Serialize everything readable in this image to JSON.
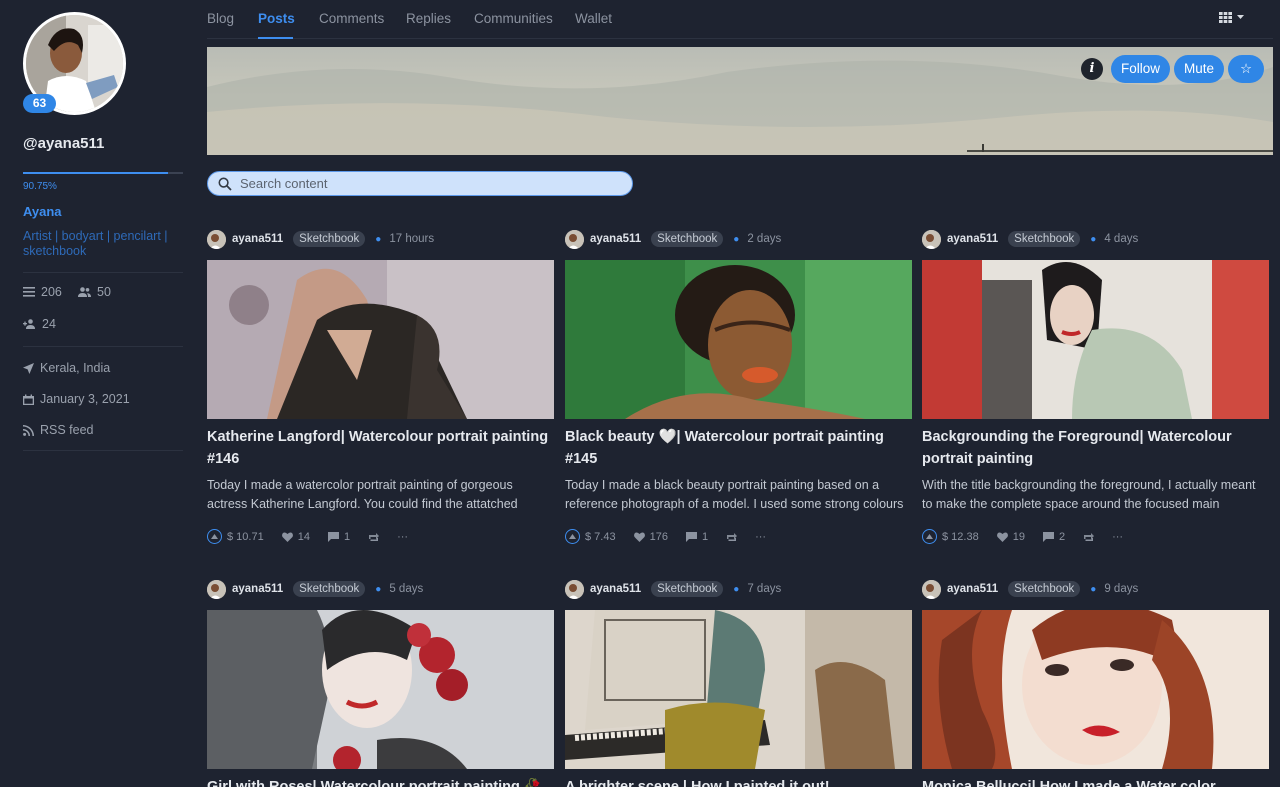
{
  "profile": {
    "username": "@ayana511",
    "reputation": "63",
    "voting_power_text": "90.75%",
    "voting_power": 0.9075,
    "display_name": "Ayana",
    "about": "Artist | bodyart | pencilart | sketchbook",
    "post_count": "206",
    "followers": "50",
    "following": "24",
    "location": "Kerala, India",
    "joined": "January 3, 2021",
    "rss": "RSS feed"
  },
  "tabs": [
    {
      "label": "Blog"
    },
    {
      "label": "Posts"
    },
    {
      "label": "Comments"
    },
    {
      "label": "Replies"
    },
    {
      "label": "Communities"
    },
    {
      "label": "Wallet"
    }
  ],
  "cover": {
    "info": "i",
    "follow": "Follow",
    "mute": "Mute",
    "star": "☆"
  },
  "search": {
    "placeholder": "Search content"
  },
  "posts": [
    {
      "author": "ayana511",
      "community": "Sketchbook",
      "age": "17 hours",
      "title": "Katherine Langford| Watercolour portrait painting #146",
      "summary": "Today I made a watercolor portrait painting of gorgeous actress Katherine Langford. You could find the attatched",
      "payout": "$ 10.71",
      "votes": "14",
      "comments": "1"
    },
    {
      "author": "ayana511",
      "community": "Sketchbook",
      "age": "2 days",
      "title": "Black beauty 🤍| Watercolour portrait painting #145",
      "summary": "Today I made a black beauty portrait painting based on a reference photograph of a model. I used some strong colours",
      "payout": "$ 7.43",
      "votes": "176",
      "comments": "1"
    },
    {
      "author": "ayana511",
      "community": "Sketchbook",
      "age": "4 days",
      "title": "Backgrounding the Foreground| Watercolour portrait painting",
      "summary": "With the title backgrounding the foreground, I actually meant to make the complete space around the focused main",
      "payout": "$ 12.38",
      "votes": "19",
      "comments": "2"
    },
    {
      "author": "ayana511",
      "community": "Sketchbook",
      "age": "5 days",
      "title": "Girl with Roses| Watercolour portrait painting 🥀",
      "summary": "",
      "payout": "",
      "votes": "",
      "comments": ""
    },
    {
      "author": "ayana511",
      "community": "Sketchbook",
      "age": "7 days",
      "title": "A brighter scene | How I painted it out!",
      "summary": "",
      "payout": "",
      "votes": "",
      "comments": ""
    },
    {
      "author": "ayana511",
      "community": "Sketchbook",
      "age": "9 days",
      "title": "Monica Bellucci| How I made a Water color portrait",
      "summary": "",
      "payout": "",
      "votes": "",
      "comments": ""
    }
  ],
  "footer_more": "···",
  "colors": {
    "accent": "#3e8ef0",
    "background": "#1e2330"
  }
}
